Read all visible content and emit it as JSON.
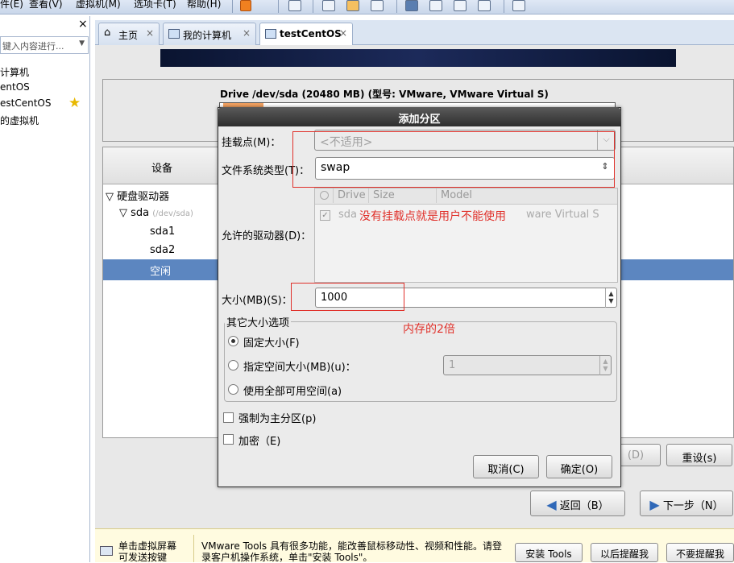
{
  "menubar": {
    "items": [
      "件(E)",
      "查看(V)",
      "虚拟机(M)",
      "选项卡(T)",
      "帮助(H)"
    ]
  },
  "library": {
    "close_glyph": "×",
    "search_placeholder": "键入内容进行...",
    "items": [
      "计算机",
      "entOS",
      "estCentOS",
      "的虚拟机"
    ]
  },
  "tabs": [
    {
      "label": "主页",
      "close": "×"
    },
    {
      "label": "我的计算机",
      "close": "×"
    },
    {
      "label": "testCentOS",
      "close": "×"
    }
  ],
  "installer": {
    "drive_label": "Drive /dev/sda (20480 MB) (型号: VMware, VMware Virtual S)",
    "device_header": "设备",
    "tree": {
      "root": "硬盘驱动器",
      "disk": "sda",
      "disk_path": "(/dev/sda)",
      "part1": "sda1",
      "part2": "sda2",
      "free": "空闲"
    },
    "buttons": {
      "delete": "(D)",
      "reset": "重设(s)",
      "back": "返回（B）",
      "next": "下一步（N）"
    }
  },
  "dialog": {
    "title": "添加分区",
    "mount_label": "挂载点(M)：",
    "mount_value": "<不适用>",
    "fs_label": "文件系统类型(T)：",
    "fs_value": "swap",
    "drives_label": "允许的驱动器(D)：",
    "drive_columns": [
      "Drive",
      "Size",
      "Model"
    ],
    "drive_row": {
      "drive": "sda",
      "model_tail": "ware Virtual S"
    },
    "size_label": "大小(MB)(S)：",
    "size_value": "1000",
    "other_group_label": "其它大小选项",
    "opt_fixed": "固定大小(F)",
    "opt_upto": "指定空间大小(MB)(u)：",
    "opt_upto_value": "1",
    "opt_fill": "使用全部可用空间(a)",
    "primary_label": "强制为主分区(p)",
    "encrypt_label": "加密（E)",
    "cancel": "取消(C)",
    "ok": "确定(O)"
  },
  "annotations": {
    "no_mount": "没有挂载点就是用户不能使用",
    "double_ram": "内存的2倍",
    "color": "#e0302a"
  },
  "bottom_bar": {
    "hint": "单击虚拟屏幕\n可发送按键",
    "message_line1": "VMware Tools 具有很多功能，能改善鼠标移动性、视频和性能。请登",
    "message_line2": "录客户机操作系统，单击\"安装 Tools\"。",
    "install_tools": "安装 Tools",
    "remind_later": "以后提醒我",
    "dont_remind": "不要提醒我"
  }
}
